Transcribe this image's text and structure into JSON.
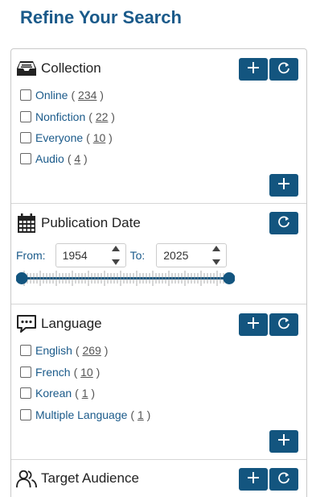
{
  "page": {
    "title": "Refine Your Search"
  },
  "collection": {
    "title": "Collection",
    "options": [
      {
        "label": "Online",
        "count": "234"
      },
      {
        "label": "Nonfiction",
        "count": "22"
      },
      {
        "label": "Everyone",
        "count": "10"
      },
      {
        "label": "Audio",
        "count": "4"
      }
    ]
  },
  "publication_date": {
    "title": "Publication Date",
    "from_label": "From:",
    "to_label": "To:",
    "from_value": "1954",
    "to_value": "2025"
  },
  "language": {
    "title": "Language",
    "options": [
      {
        "label": "English",
        "count": "269"
      },
      {
        "label": "French",
        "count": "10"
      },
      {
        "label": "Korean",
        "count": "1"
      },
      {
        "label": "Multiple Language",
        "count": "1"
      }
    ]
  },
  "target_audience": {
    "title": "Target Audience"
  },
  "colors": {
    "accent": "#13557f",
    "title": "#1a5a8a",
    "link": "#1a5a8a"
  },
  "icons": {
    "add": "plus-icon",
    "reset": "refresh-icon",
    "collection": "inbox-tray-icon",
    "date": "calendar-icon",
    "language": "speech-bubble-icon",
    "audience": "people-icon"
  }
}
